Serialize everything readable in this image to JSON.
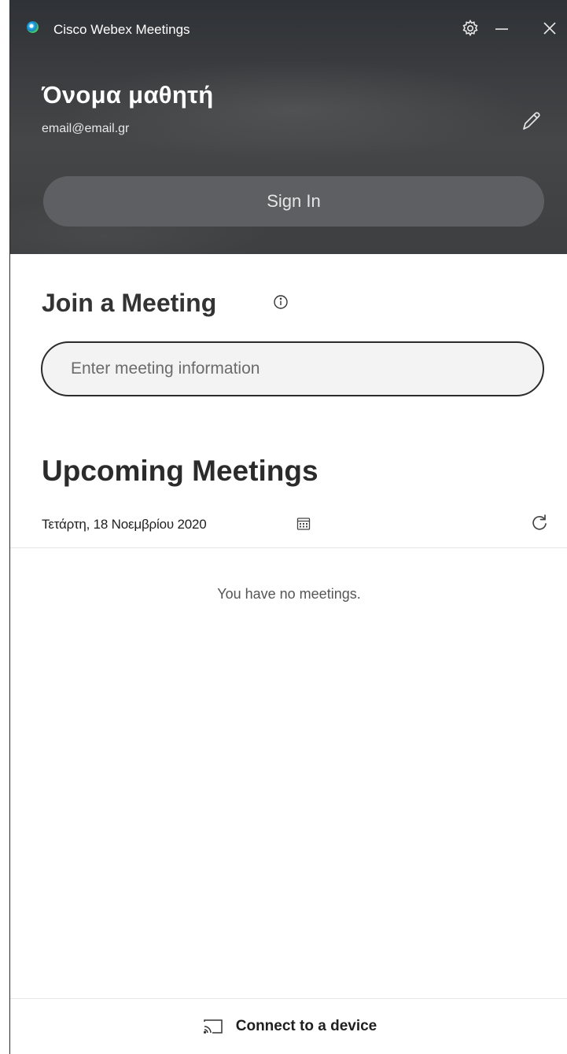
{
  "titlebar": {
    "app_title": "Cisco Webex Meetings",
    "icons": [
      "app-logo-icon",
      "gear-icon",
      "minimize-icon",
      "close-icon"
    ]
  },
  "profile": {
    "name": "Όνομα μαθητή",
    "email": "email@email.gr",
    "edit_icon": "pencil-icon",
    "sign_in_label": "Sign In"
  },
  "join": {
    "title": "Join a Meeting",
    "info_icon": "info-icon",
    "input_placeholder": "Enter meeting information",
    "input_value": ""
  },
  "upcoming": {
    "title": "Upcoming Meetings",
    "date": "Τετάρτη, 18 Νοεμβρίου 2020",
    "calendar_icon": "calendar-icon",
    "refresh_icon": "refresh-icon",
    "empty_message": "You have no meetings."
  },
  "footer": {
    "connect_label": "Connect to a device",
    "cast_icon": "cast-icon"
  },
  "colors": {
    "header_bg": "#3b3d40",
    "signin_bg": "#5d5f62",
    "text_dark": "#333333",
    "input_bg": "#f3f3f3"
  }
}
